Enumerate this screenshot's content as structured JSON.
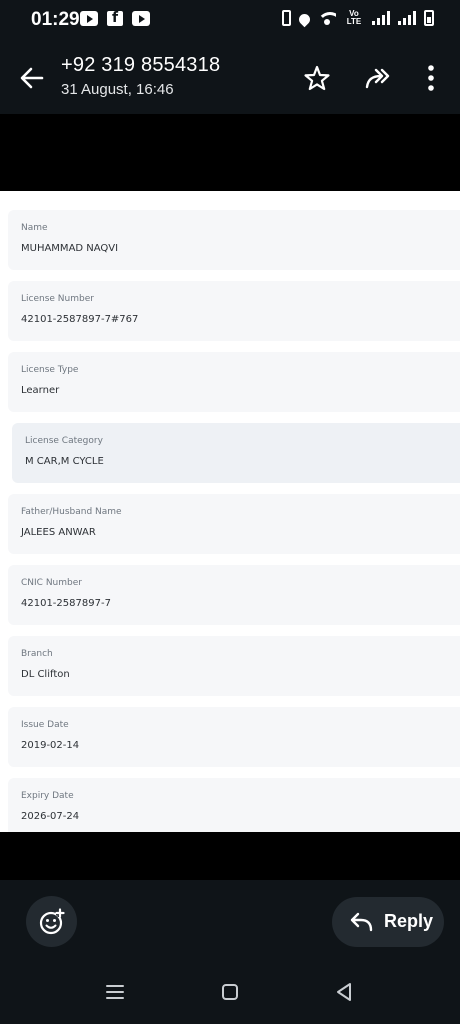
{
  "status_bar": {
    "time": "01:29",
    "app_icons": [
      "youtube-icon",
      "facebook-icon",
      "youtube-icon"
    ],
    "system_icons": [
      "vibrate-icon",
      "location-icon",
      "wifi-icon",
      "volte-icon",
      "signal-icon",
      "signal-icon",
      "battery-icon"
    ],
    "volte_line1": "Vo",
    "volte_line2": "LTE"
  },
  "header": {
    "title": "+92 319 8554318",
    "subtitle": "31 August, 16:46",
    "actions": [
      "star-icon",
      "forward-icon",
      "more-icon"
    ]
  },
  "license_card": {
    "fields": [
      {
        "label": "Name",
        "value": "MUHAMMAD NAQVI"
      },
      {
        "label": "License Number",
        "value": "42101-2587897-7#767"
      },
      {
        "label": "License Type",
        "value": "Learner"
      },
      {
        "label": "License Category",
        "value": "M CAR,M CYCLE"
      },
      {
        "label": "Father/Husband Name",
        "value": "JALEES ANWAR"
      },
      {
        "label": "CNIC Number",
        "value": "42101-2587897-7"
      },
      {
        "label": "Branch",
        "value": "DL Clifton"
      },
      {
        "label": "Issue Date",
        "value": "2019-02-14"
      },
      {
        "label": "Expiry Date",
        "value": "2026-07-24"
      }
    ]
  },
  "bottom_bar": {
    "reply_label": "Reply"
  },
  "colors": {
    "bar_background": "#0f1418",
    "button_background": "#232a30",
    "field_background": "#f6f7f9"
  }
}
